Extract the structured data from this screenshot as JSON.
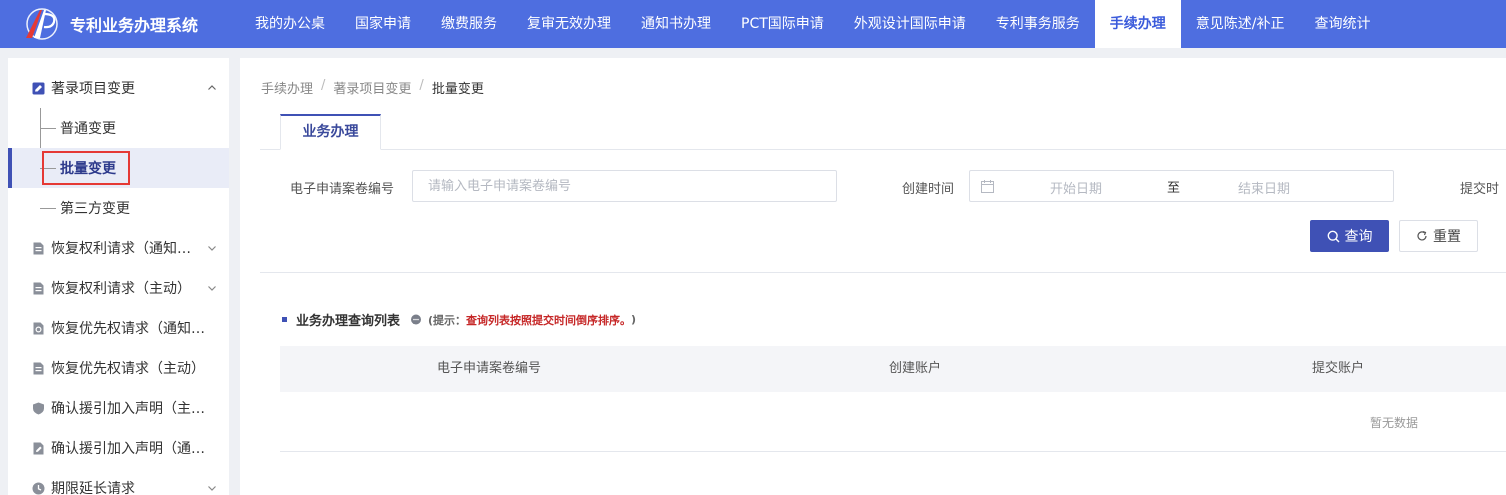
{
  "app": {
    "title": "专利业务办理系统"
  },
  "nav": {
    "items": [
      {
        "label": "我的办公桌"
      },
      {
        "label": "国家申请"
      },
      {
        "label": "缴费服务"
      },
      {
        "label": "复审无效办理"
      },
      {
        "label": "通知书办理"
      },
      {
        "label": "PCT国际申请"
      },
      {
        "label": "外观设计国际申请"
      },
      {
        "label": "专利事务服务"
      },
      {
        "label": "手续办理"
      },
      {
        "label": "意见陈述/补正"
      },
      {
        "label": "查询统计"
      }
    ],
    "active": "手续办理"
  },
  "sidebar": {
    "group0": {
      "label": "著录项目变更",
      "icon": "document-edit-icon",
      "expanded": true
    },
    "subitems": [
      {
        "label": "普通变更"
      },
      {
        "label": "批量变更"
      },
      {
        "label": "第三方变更"
      }
    ],
    "active_subitem": "批量变更",
    "groups": [
      {
        "label": "恢复权利请求（通知书）",
        "icon": "document-icon",
        "chevron": true
      },
      {
        "label": "恢复权利请求（主动）",
        "icon": "document-icon",
        "chevron": true
      },
      {
        "label": "恢复优先权请求（通知书）",
        "icon": "document-refresh-icon",
        "chevron": false
      },
      {
        "label": "恢复优先权请求（主动）",
        "icon": "document-icon",
        "chevron": false
      },
      {
        "label": "确认援引加入声明（主动）",
        "icon": "shield-icon",
        "chevron": false
      },
      {
        "label": "确认援引加入声明（通知书）",
        "icon": "document-edit-icon",
        "chevron": false
      },
      {
        "label": "期限延长请求",
        "icon": "clock-icon",
        "chevron": true
      }
    ]
  },
  "breadcrumb": {
    "items": [
      "手续办理",
      "著录项目变更",
      "批量变更"
    ]
  },
  "tabs": {
    "active_label": "业务办理"
  },
  "form": {
    "case_no_label": "电子申请案卷编号",
    "case_no_placeholder": "请输入电子申请案卷编号",
    "case_no_value": "",
    "created_label": "创建时间",
    "start_placeholder": "开始日期",
    "range_sep": "至",
    "end_placeholder": "结束日期",
    "submit_label": "提交时"
  },
  "buttons": {
    "search": "查询",
    "reset": "重置"
  },
  "list": {
    "title": "业务办理查询列表",
    "hint_prefix": "(提示：",
    "hint_text": "查询列表按照提交时间倒序排序。",
    "hint_suffix": ")",
    "columns": [
      "电子申请案卷编号",
      "创建账户",
      "提交账户"
    ],
    "empty_text": "暂无数据"
  },
  "colors": {
    "topbar": "#4e6ee0",
    "primary": "#3f51b5",
    "highlight": "#e53935",
    "hint_red": "#c62828"
  }
}
